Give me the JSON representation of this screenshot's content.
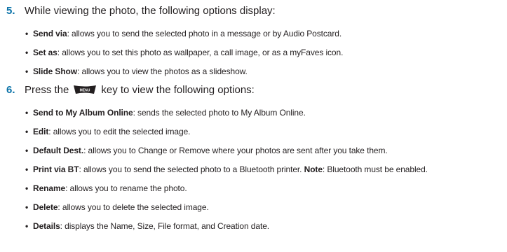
{
  "step5": {
    "number": "5.",
    "text": "While viewing the photo, the following options display:",
    "bullets": [
      {
        "term": "Send via",
        "desc": ": allows you to send the selected photo in a message or by Audio Postcard."
      },
      {
        "term": "Set as",
        "desc": ": allows you to set this photo as wallpaper, a call image, or as a myFaves icon."
      },
      {
        "term": "Slide Show",
        "desc": ": allows you to view the photos as a slideshow."
      }
    ]
  },
  "step6": {
    "number": "6.",
    "text_before": "Press the",
    "key_label": "MENU",
    "text_after": "key to view the following options:",
    "bullets": [
      {
        "term": "Send to My Album Online",
        "desc": ": sends the selected photo to My Album Online."
      },
      {
        "term": "Edit",
        "desc": ": allows you to edit the selected image."
      },
      {
        "term": "Default Dest.",
        "desc": ": allows you to Change or Remove where your photos are sent after you take them."
      },
      {
        "term": "Print via BT",
        "desc": ": allows you to send the selected photo to a Bluetooth printer.",
        "note_term": "Note",
        "note_desc": ": Bluetooth must be enabled."
      },
      {
        "term": "Rename",
        "desc": ": allows you to rename the photo."
      },
      {
        "term": "Delete",
        "desc": ": allows you to delete the selected image."
      },
      {
        "term": "Details",
        "desc": ": displays the Name, Size, File format, and Creation date."
      }
    ]
  },
  "bullet_char": "•",
  "colors": {
    "step_number": "#0a72a8",
    "text": "#231f20",
    "menu_key": "#231f20"
  }
}
